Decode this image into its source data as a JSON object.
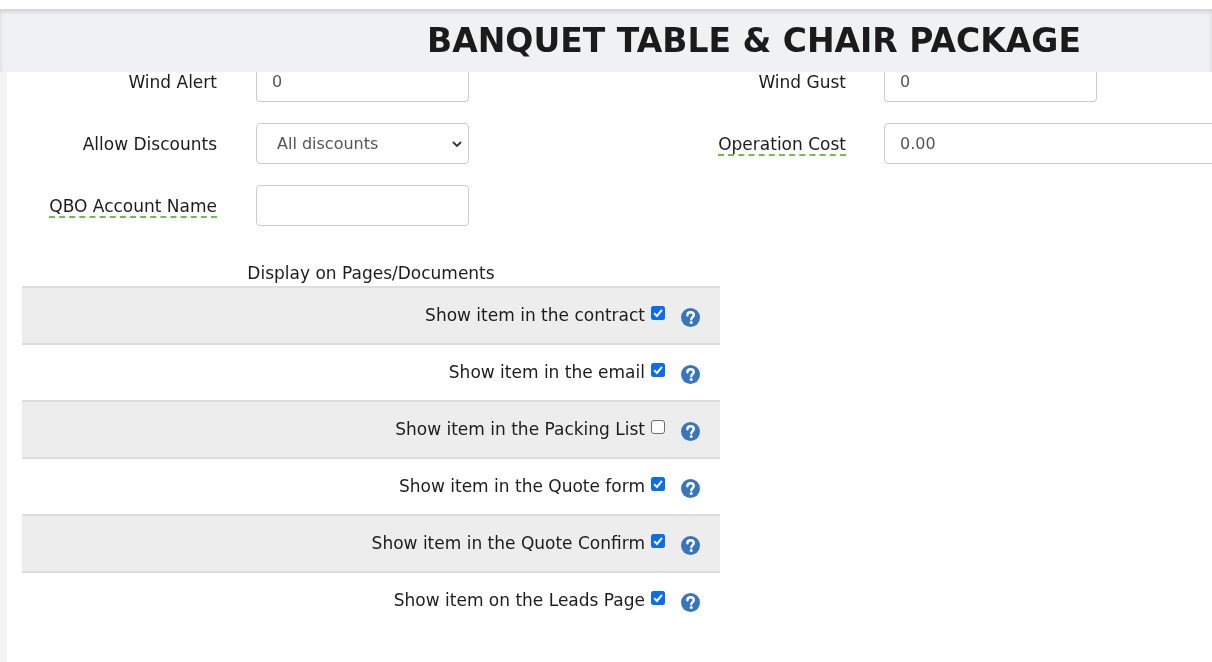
{
  "header": {
    "title": "BANQUET TABLE & CHAIR PACKAGE"
  },
  "form": {
    "left": [
      {
        "label": "Wind Alert",
        "kind": "input",
        "value": "0",
        "hint": false
      },
      {
        "label": "Allow Discounts",
        "kind": "select",
        "value": "All discounts",
        "hint": false
      },
      {
        "label": "QBO Account Name",
        "kind": "input",
        "hint": true
      }
    ],
    "right": [
      {
        "label": "Wind Gust",
        "kind": "input",
        "value": "0",
        "hint": false
      },
      {
        "label": "Operation Cost",
        "kind": "input",
        "value": "0.00",
        "hint": true
      }
    ]
  },
  "display_options": {
    "title": "Display on Pages/Documents",
    "rows": [
      {
        "label": "Show item in the contract",
        "checked": true
      },
      {
        "label": "Show item in the email",
        "checked": true
      },
      {
        "label": "Show item in the Packing List",
        "checked": false
      },
      {
        "label": "Show item in the Quote form",
        "checked": true
      },
      {
        "label": "Show item in the Quote Confirm",
        "checked": true
      },
      {
        "label": "Show item on the Leads Page",
        "checked": true
      }
    ]
  }
}
